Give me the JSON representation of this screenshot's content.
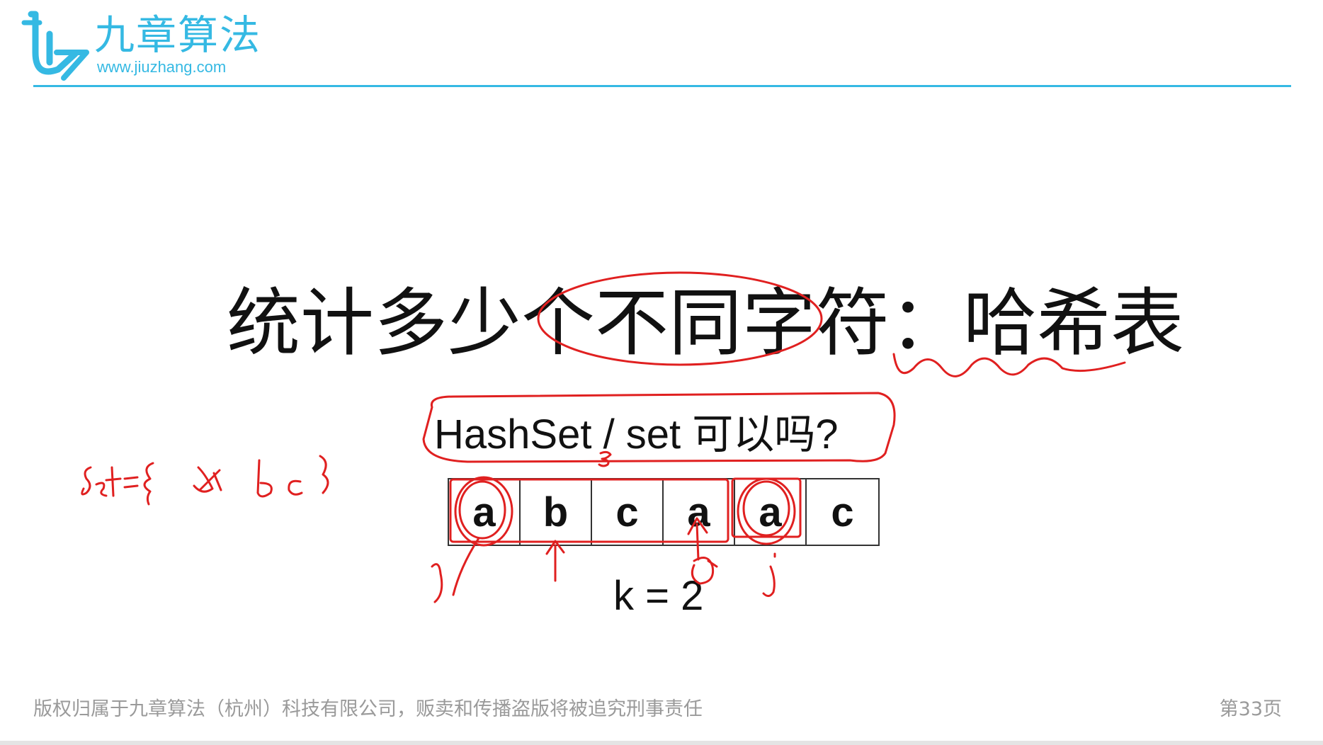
{
  "header": {
    "brand_name": "九章算法",
    "brand_url": "www.jiuzhang.com",
    "accent_color": "#35b9e3",
    "logo_icon": "jiuzhang-logo-icon"
  },
  "slide": {
    "title": "统计多少个不同字符：哈希表",
    "subtitle": "HashSet / set 可以吗?",
    "array": [
      "a",
      "b",
      "c",
      "a",
      "a",
      "c"
    ],
    "k_label": "k = 2"
  },
  "footer": {
    "copyright": "版权归属于九章算法（杭州）科技有限公司，贩卖和传播盗版将被追究刑事责任",
    "page": "第33页"
  },
  "annotations": {
    "ink_color": "#e02020",
    "handwritten_note": "set={a bc}",
    "marks": [
      "3",
      "i",
      "j"
    ]
  }
}
